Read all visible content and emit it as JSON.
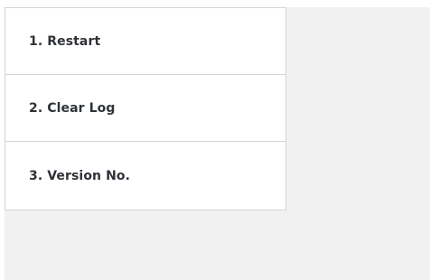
{
  "menu": {
    "items": [
      {
        "label": "1. Restart"
      },
      {
        "label": "2. Clear Log"
      },
      {
        "label": "3. Version No."
      }
    ]
  },
  "colors": {
    "page_background": "#ffffff",
    "panel_background": "#f0f1f0",
    "menu_background": "#ffffff",
    "border": "#d4d5d4",
    "text": "#2f3338"
  }
}
